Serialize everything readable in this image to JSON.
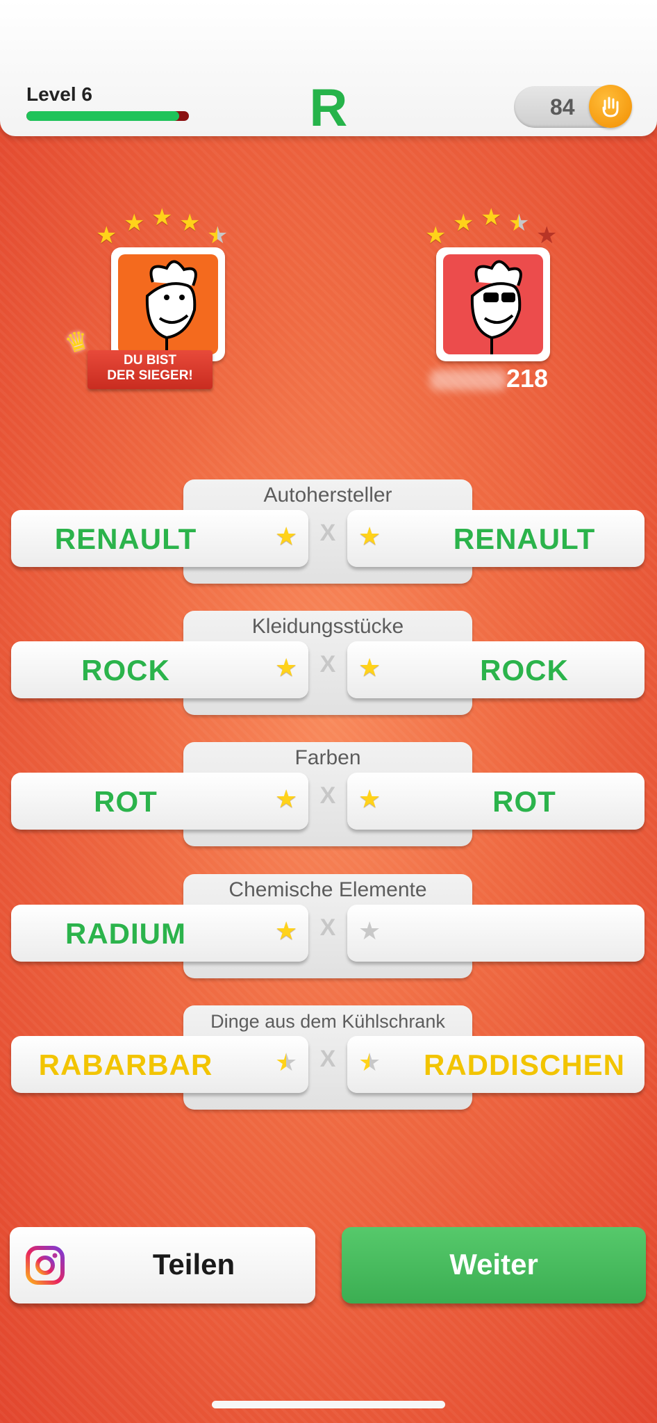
{
  "header": {
    "level_label": "Level 6",
    "level_progress": 0.94,
    "letter": "R",
    "coins": "84"
  },
  "players": {
    "me": {
      "stars": 4.5,
      "winner_banner": "DU BIST\nDER SIEGER!"
    },
    "opponent": {
      "stars": 3.5,
      "name": "218"
    }
  },
  "categories": [
    {
      "title": "Autohersteller",
      "my_answer": "RENAULT",
      "my_star": "full",
      "opp_answer": "RENAULT",
      "opp_star": "full",
      "color": "green"
    },
    {
      "title": "Kleidungsstücke",
      "my_answer": "ROCK",
      "my_star": "full",
      "opp_answer": "ROCK",
      "opp_star": "full",
      "color": "green"
    },
    {
      "title": "Farben",
      "my_answer": "ROT",
      "my_star": "full",
      "opp_answer": "ROT",
      "opp_star": "full",
      "color": "green"
    },
    {
      "title": "Chemische Elemente",
      "my_answer": "RADIUM",
      "my_star": "full",
      "opp_answer": "",
      "opp_star": "empty",
      "color": "green"
    },
    {
      "title": "Dinge aus dem Kühlschrank",
      "my_answer": "RABARBAR",
      "my_star": "half",
      "opp_answer": "RADDISCHEN",
      "opp_star": "half",
      "color": "yellow"
    }
  ],
  "vs_symbol": "X",
  "buttons": {
    "share_label": "Teilen",
    "next_label": "Weiter"
  },
  "colors": {
    "accent_green": "#2bb34b",
    "answer_yellow": "#f2c400",
    "background": "#ef6a42"
  }
}
